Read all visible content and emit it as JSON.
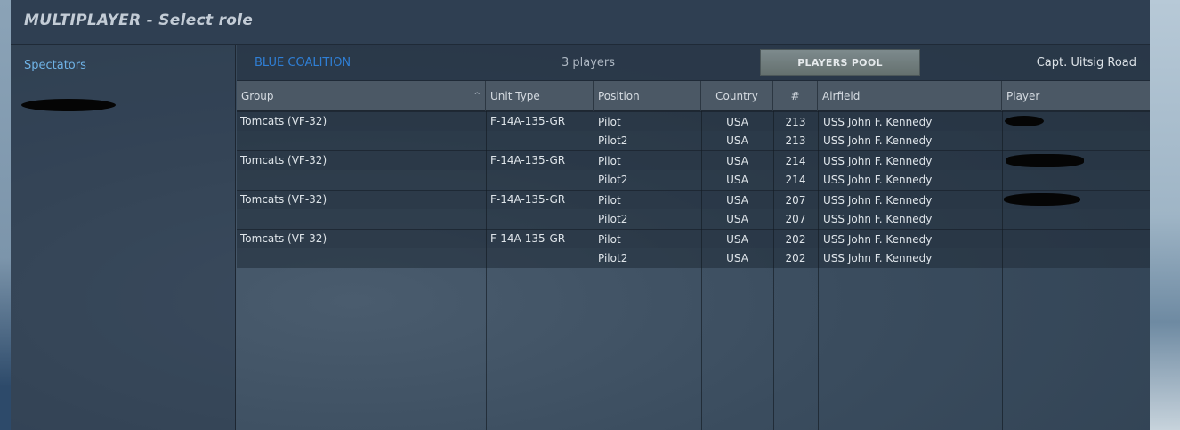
{
  "window": {
    "title": "MULTIPLAYER - Select role"
  },
  "sidebar": {
    "spectators_label": "Spectators"
  },
  "toolbar": {
    "coalition_label": "BLUE COALITION",
    "players_count": "3 players",
    "pool_button_label": "PLAYERS POOL",
    "server_name": "Capt. Uitsig Road"
  },
  "table": {
    "columns": [
      "Group",
      "Unit Type",
      "Position",
      "Country",
      "#",
      "Airfield",
      "Player"
    ],
    "sort_indicator": "^",
    "rows": [
      {
        "group": "Tomcats (VF-32)",
        "unit_type": "F-14A-135-GR",
        "position": "Pilot",
        "country": "USA",
        "number": "213",
        "airfield": "USS John F. Kennedy",
        "player": ""
      },
      {
        "group": "",
        "unit_type": "",
        "position": "Pilot2",
        "country": "USA",
        "number": "213",
        "airfield": "USS John F. Kennedy",
        "player": ""
      },
      {
        "group": "Tomcats (VF-32)",
        "unit_type": "F-14A-135-GR",
        "position": "Pilot",
        "country": "USA",
        "number": "214",
        "airfield": "USS John F. Kennedy",
        "player": ""
      },
      {
        "group": "",
        "unit_type": "",
        "position": "Pilot2",
        "country": "USA",
        "number": "214",
        "airfield": "USS John F. Kennedy",
        "player": ""
      },
      {
        "group": "Tomcats (VF-32)",
        "unit_type": "F-14A-135-GR",
        "position": "Pilot",
        "country": "USA",
        "number": "207",
        "airfield": "USS John F. Kennedy",
        "player": ""
      },
      {
        "group": "",
        "unit_type": "",
        "position": "Pilot2",
        "country": "USA",
        "number": "207",
        "airfield": "USS John F. Kennedy",
        "player": ""
      },
      {
        "group": "Tomcats (VF-32)",
        "unit_type": "F-14A-135-GR",
        "position": "Pilot",
        "country": "USA",
        "number": "202",
        "airfield": "USS John F. Kennedy",
        "player": ""
      },
      {
        "group": "",
        "unit_type": "",
        "position": "Pilot2",
        "country": "USA",
        "number": "202",
        "airfield": "USS John F. Kennedy",
        "player": ""
      }
    ]
  },
  "colors": {
    "link_blue": "#6fb3e6",
    "coalition_blue": "#2f7fd6",
    "button_gray": "#717d7e"
  }
}
